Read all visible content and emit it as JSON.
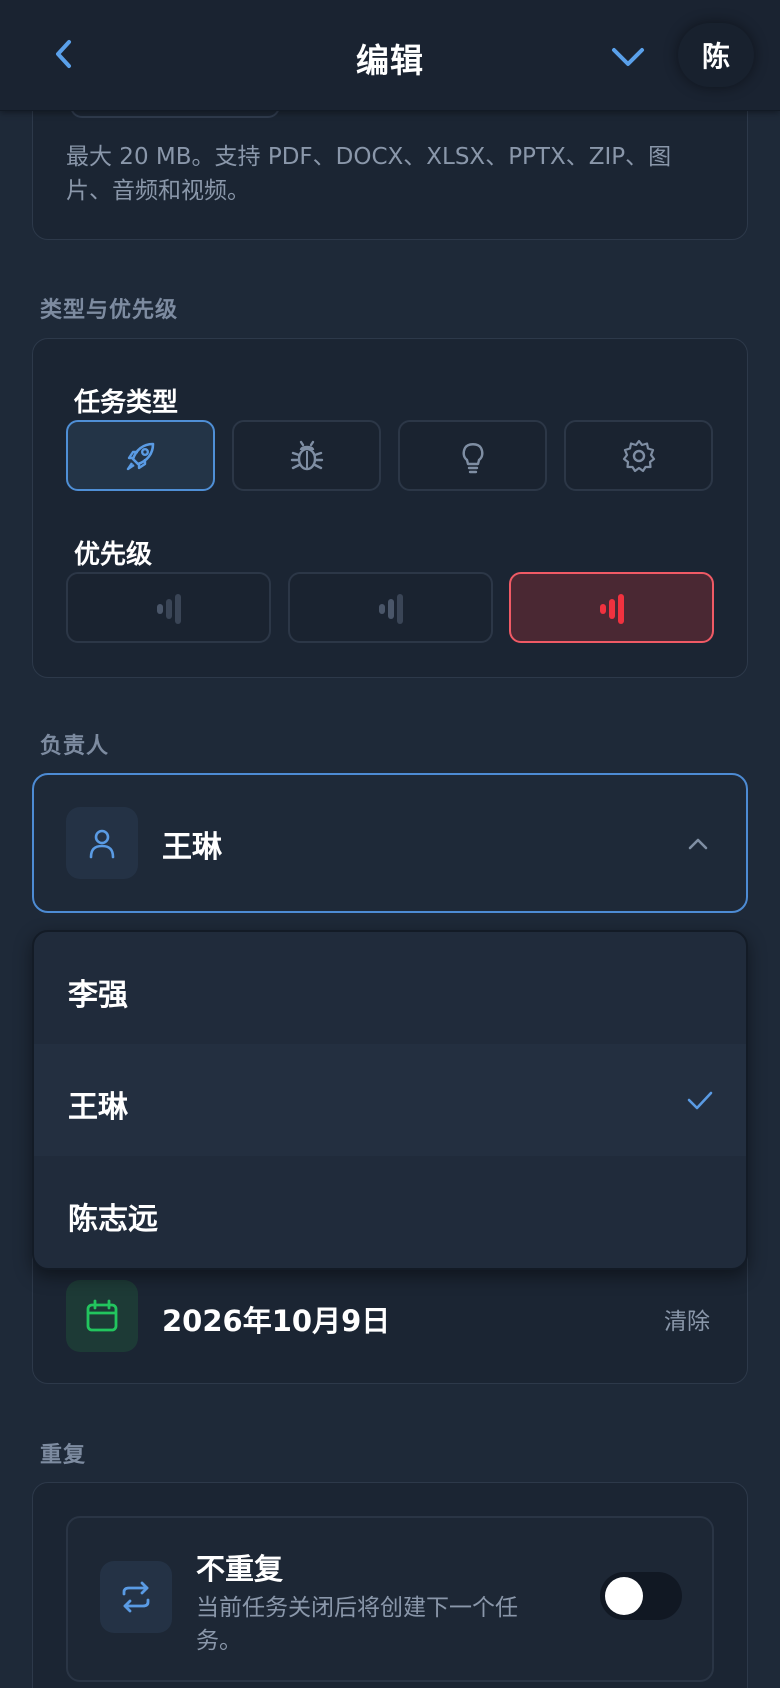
{
  "header": {
    "title": "编辑",
    "avatar_initial": "陈",
    "back_icon": "chevron-left-icon",
    "collapse_icon": "chevron-down-icon"
  },
  "attachments": {
    "hint": "最大 20 MB。支持 PDF、DOCX、XLSX、PPTX、ZIP、图片、音频和视频。"
  },
  "type_priority": {
    "section_label": "类型与优先级",
    "task_type_label": "任务类型",
    "task_types": [
      {
        "icon": "rocket-icon",
        "selected": true
      },
      {
        "icon": "bug-icon",
        "selected": false
      },
      {
        "icon": "lightbulb-icon",
        "selected": false
      },
      {
        "icon": "gear-icon",
        "selected": false
      }
    ],
    "priority_label": "优先级",
    "priorities": [
      {
        "icon": "signal-low-icon",
        "level": 1,
        "selected": false
      },
      {
        "icon": "signal-medium-icon",
        "level": 2,
        "selected": false
      },
      {
        "icon": "signal-high-icon",
        "level": 3,
        "selected": true
      }
    ]
  },
  "assignee": {
    "section_label": "负责人",
    "selected": "王琳",
    "options": [
      {
        "label": "李强",
        "selected": false
      },
      {
        "label": "王琳",
        "selected": true
      },
      {
        "label": "陈志远",
        "selected": false
      }
    ]
  },
  "due_date": {
    "value": "2026年10月9日",
    "clear_label": "清除"
  },
  "repeat": {
    "section_label": "重复",
    "title": "不重复",
    "description": "当前任务关闭后将创建下一个任务。",
    "enabled": false
  },
  "colors": {
    "accent": "#4f8fd6",
    "danger": "#f0323f",
    "success": "#22c55e",
    "background": "#1e2938"
  }
}
